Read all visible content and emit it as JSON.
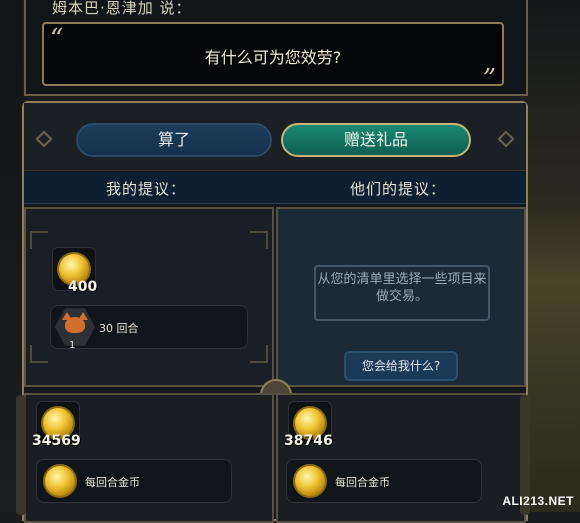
{
  "dialog": {
    "speaker": "姆本巴·恩津加 说：",
    "message": "有什么可为您效劳?"
  },
  "buttons": {
    "cancel": "算了",
    "gift": "赠送礼品"
  },
  "offers": {
    "mine_label": "我的提议：",
    "theirs_label": "他们的提议：",
    "mine_gold": "400",
    "mine_item_label": "30 回合",
    "mine_item_count": "1",
    "theirs_hint": "从您的清单里选择一些项目来做交易。",
    "theirs_ask_button": "您会给我什么?"
  },
  "inventory": {
    "left_gold": "34569",
    "left_per_turn": "每回合金币",
    "right_gold": "38746",
    "right_per_turn": "每回合金币"
  },
  "watermark": "ALI213.NET",
  "colors": {
    "gift_button": "#1a8a72",
    "cancel_button": "#1d3d5c",
    "frame_gold": "#8d7f57",
    "header_blue": "#0d1f30"
  },
  "icons": [
    "gold-coin-icon",
    "fox-icon",
    "quote-open-icon",
    "quote-close-icon",
    "diamond-ornament-icon"
  ]
}
